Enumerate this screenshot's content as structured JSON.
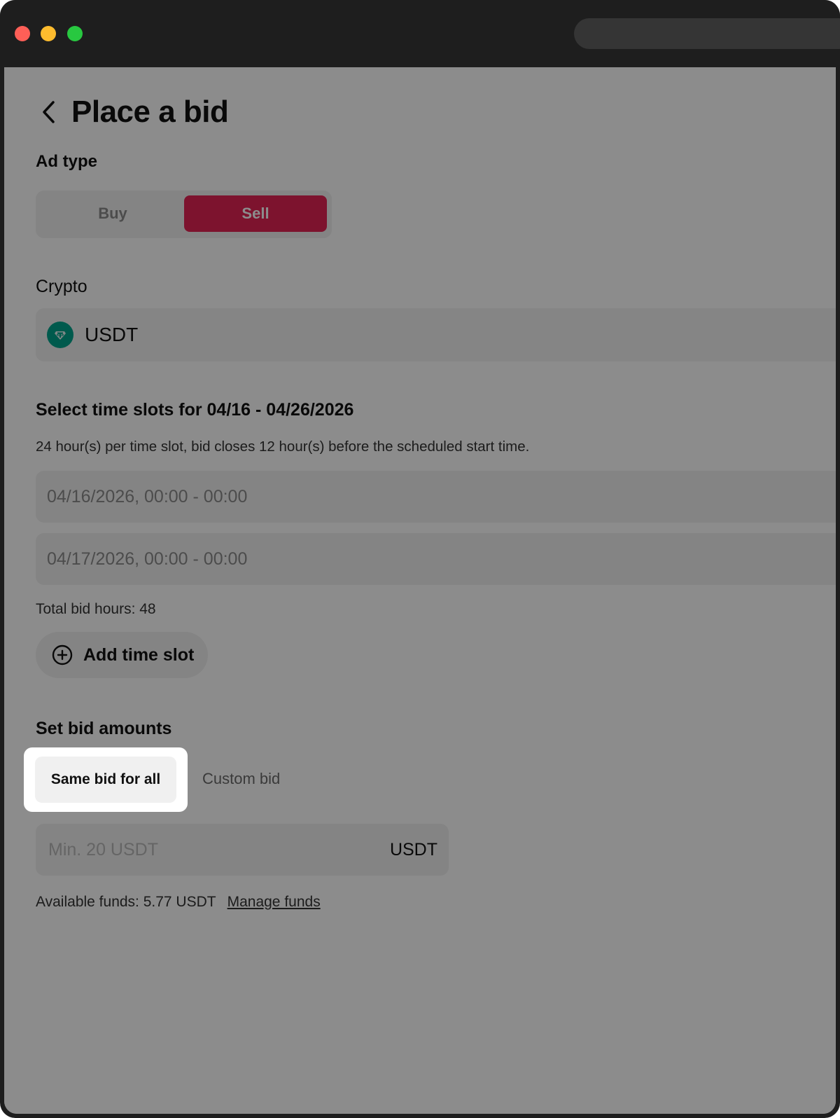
{
  "page": {
    "title": "Place a bid",
    "ad_type_label": "Ad type",
    "ad_type_options": [
      "Buy",
      "Sell"
    ],
    "ad_type_selected": "Sell",
    "crypto_label": "Crypto",
    "crypto_value": "USDT",
    "time_slots_heading": "Select time slots for 04/16 - 04/26/2026",
    "time_slots_helper": "24 hour(s) per time slot, bid closes 12 hour(s) before the scheduled start time.",
    "time_slots": [
      "04/16/2026, 00:00 - 00:00",
      "04/17/2026, 00:00 - 00:00"
    ],
    "total_bid_hours": "Total bid hours: 48",
    "add_time_slot_label": "Add time slot",
    "bid_amounts_heading": "Set bid amounts",
    "bid_mode_options": [
      "Same bid for all",
      "Custom bid"
    ],
    "bid_mode_selected": "Same bid for all",
    "amount_placeholder": "Min. 20 USDT",
    "amount_unit": "USDT",
    "available_funds": "Available funds: 5.77 USDT",
    "manage_funds_label": "Manage funds"
  },
  "colors": {
    "sell_accent": "#e32455",
    "coin_icon": "#00a48c",
    "window_chrome": "#1e1e1e"
  },
  "icons": {
    "back": "chevron-left-icon",
    "coin": "tether-icon",
    "add": "plus-circle-icon"
  }
}
